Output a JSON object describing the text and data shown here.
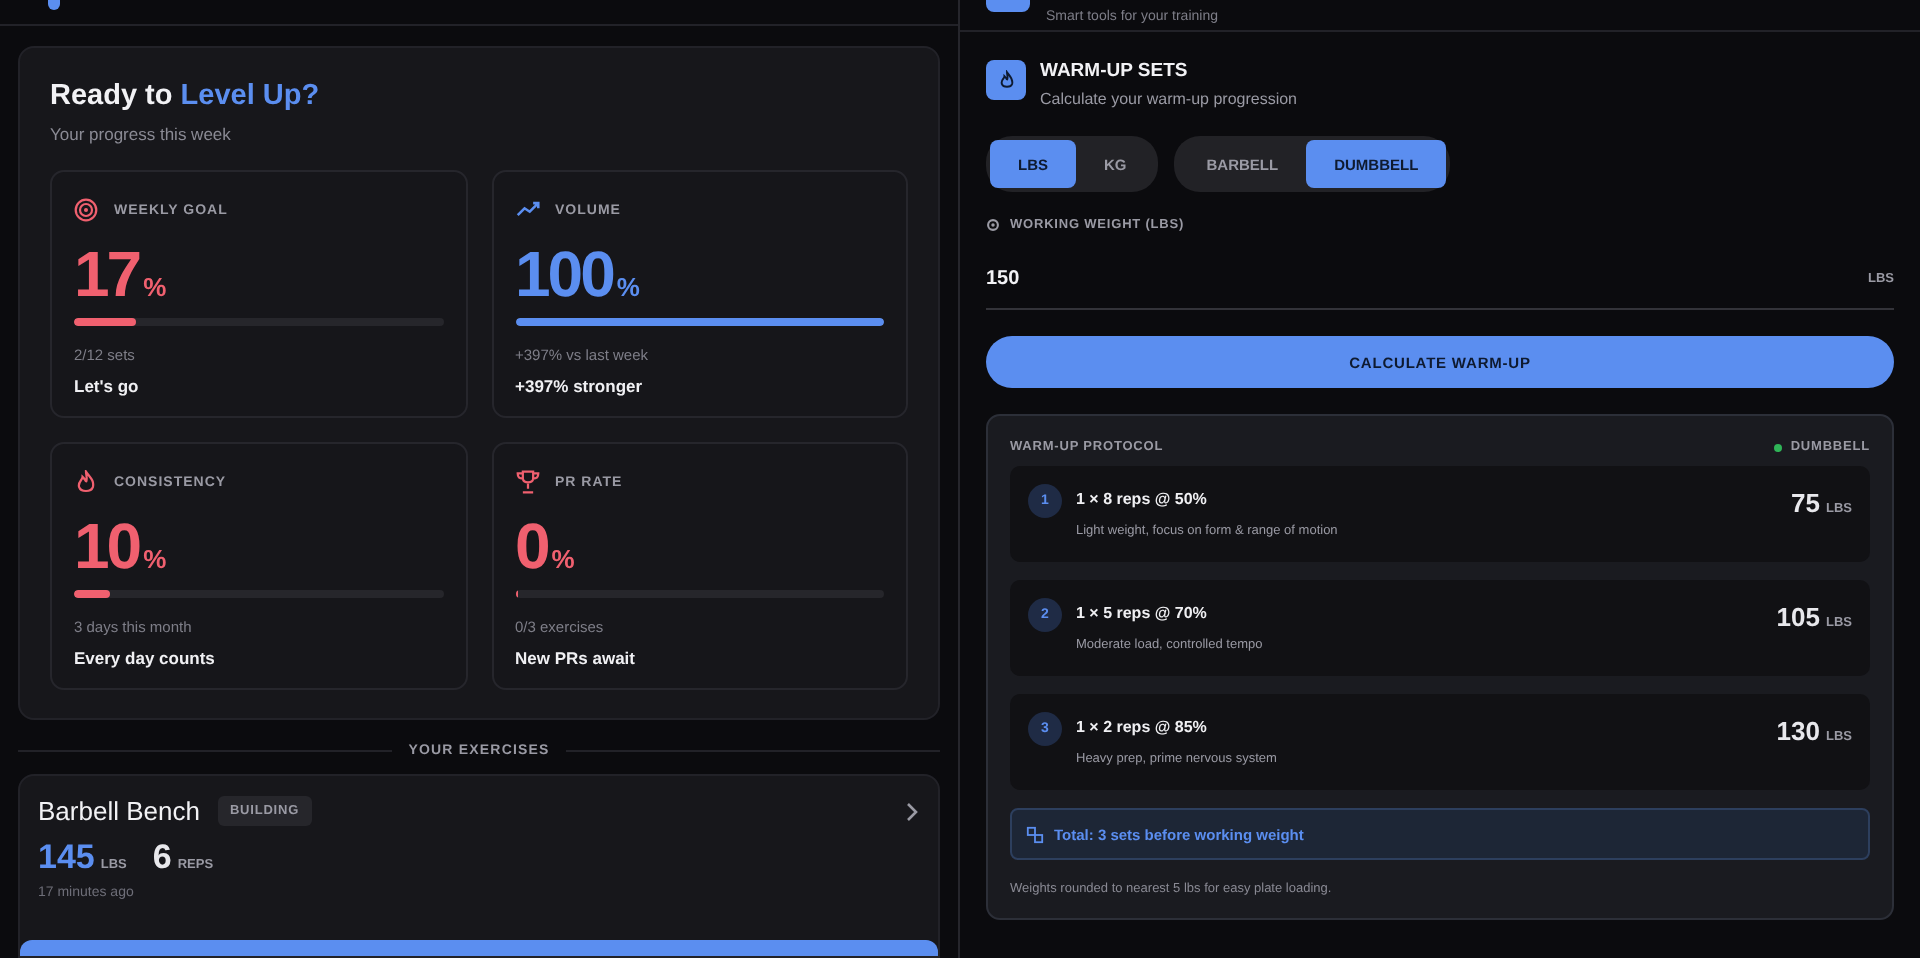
{
  "left": {
    "hero": {
      "title_prefix": "Ready to",
      "title_accent": "Level Up?",
      "subtitle": "Your progress this week"
    },
    "stats": [
      {
        "kind": "target",
        "label": "WEEKLY GOAL",
        "value": "17",
        "unit": "%",
        "color": "#f0606f",
        "level": 0.17,
        "detail": "2/12 sets",
        "note": "Let's go"
      },
      {
        "kind": "trend",
        "label": "VOLUME",
        "value": "100",
        "unit": "%",
        "color": "#5b8ef0",
        "level": 1.0,
        "detail": "+397% vs last week",
        "note": "+397% stronger"
      },
      {
        "kind": "flame",
        "label": "CONSISTENCY",
        "value": "10",
        "unit": "%",
        "color": "#f0606f",
        "level": 0.1,
        "detail": "3 days this month",
        "note": "Every day counts"
      },
      {
        "kind": "trophy",
        "label": "PR RATE",
        "value": "0",
        "unit": "%",
        "color": "#f0606f",
        "level": 0,
        "detail": "0/3 exercises",
        "note": "New PRs await"
      }
    ],
    "section_label": "YOUR EXERCISES",
    "exercise": {
      "name": "Barbell Bench",
      "badge": "BUILDING",
      "weight": "145",
      "weight_unit": "LBS",
      "reps": "6",
      "reps_unit": "REPS",
      "time": "17 minutes ago"
    }
  },
  "right": {
    "header_subtitle": "Smart tools for your training",
    "title": "WARM-UP SETS",
    "subtitle": "Calculate your warm-up progression",
    "units": [
      {
        "label": "LBS",
        "selected": true
      },
      {
        "label": "KG",
        "selected": false
      }
    ],
    "equipment": [
      {
        "label": "BARBELL",
        "selected": false
      },
      {
        "label": "DUMBBELL",
        "selected": true
      }
    ],
    "weight_label": "WORKING WEIGHT (LBS)",
    "weight_value": "150",
    "weight_suffix": "LBS",
    "button": "CALCULATE WARM-UP",
    "protocol": {
      "title": "WARM-UP PROTOCOL",
      "badge": "DUMBBELL",
      "color": "#2fb457",
      "sets": [
        {
          "number": "1",
          "scheme": "1 × 8 reps @ 50%",
          "description": "Light weight, focus on form & range of motion",
          "weight": "75",
          "unit": "LBS"
        },
        {
          "number": "2",
          "scheme": "1 × 5 reps @ 70%",
          "description": "Moderate load, controlled tempo",
          "weight": "105",
          "unit": "LBS"
        },
        {
          "number": "3",
          "scheme": "1 × 2 reps @ 85%",
          "description": "Heavy prep, prime nervous system",
          "weight": "130",
          "unit": "LBS"
        }
      ],
      "total": "Total: 3 sets before working weight",
      "footnote": "Weights rounded to nearest 5 lbs for easy plate loading."
    }
  }
}
